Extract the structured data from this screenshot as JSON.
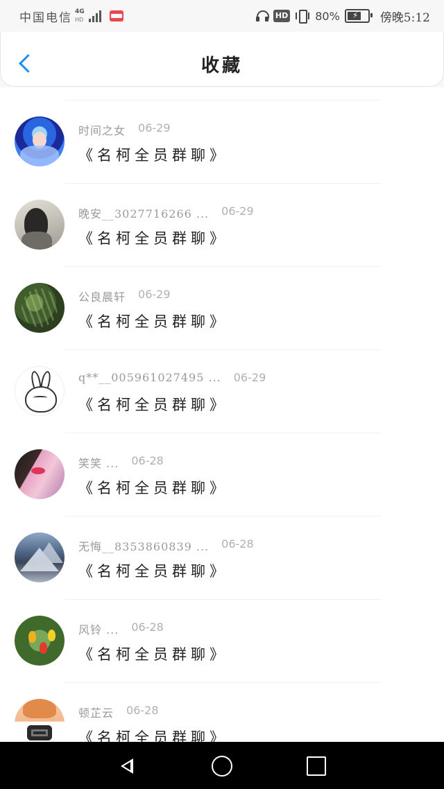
{
  "status_bar": {
    "carrier": "中国电信",
    "network_type": "4G",
    "network_sub": "HD",
    "hd_badge": "HD",
    "battery_percent": "80%",
    "time": "傍晚5:12",
    "icons": [
      "signal-icon",
      "mail-icon",
      "headphone-icon",
      "hd-icon",
      "vibrate-icon",
      "battery-icon"
    ]
  },
  "header": {
    "title": "收藏",
    "back_icon": "chevron-left-icon",
    "accent_color": "#1a8ef5"
  },
  "favorites": [
    {
      "sender": "时间之女",
      "date": "06-29",
      "title": "《名柯全员群聊》"
    },
    {
      "sender": "晚安__3027716266 ...",
      "date": "06-29",
      "title": "《名柯全员群聊》"
    },
    {
      "sender": "公良晨轩",
      "date": "06-29",
      "title": "《名柯全员群聊》"
    },
    {
      "sender": "q**__005961027495 ...",
      "date": "06-29",
      "title": "《名柯全员群聊》"
    },
    {
      "sender": "笑笑 ...",
      "date": "06-28",
      "title": "《名柯全员群聊》"
    },
    {
      "sender": "无悔__8353860839 ...",
      "date": "06-28",
      "title": "《名柯全员群聊》"
    },
    {
      "sender": "风铃 ...",
      "date": "06-28",
      "title": "《名柯全员群聊》"
    },
    {
      "sender": "顿芷云",
      "date": "06-28",
      "title": "《名柯全员群聊》"
    }
  ],
  "nav_bar": {
    "icons": [
      "nav-back-icon",
      "nav-home-icon",
      "nav-recent-apps-icon"
    ]
  }
}
